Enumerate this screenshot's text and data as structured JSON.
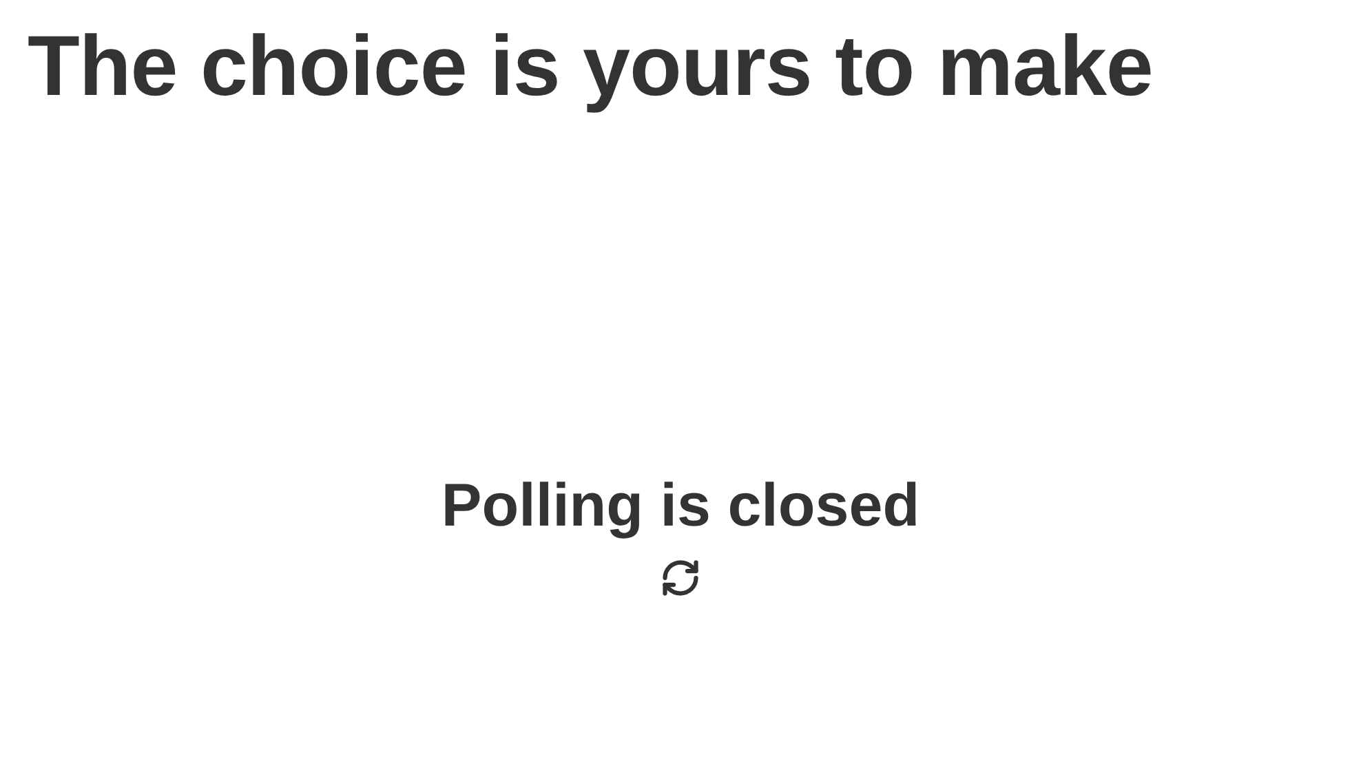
{
  "title": "The choice is yours to make",
  "status": {
    "message": "Polling is closed"
  }
}
